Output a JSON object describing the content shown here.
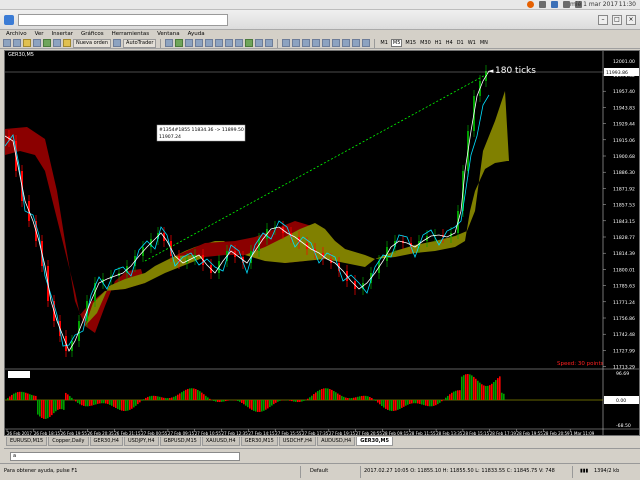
{
  "system_bar": {
    "date": "mié 1 mar 2017",
    "time": "11:30",
    "icons": [
      "firefox-icon",
      "wifi-icon",
      "bluetooth-icon",
      "volume-icon",
      "battery-icon"
    ]
  },
  "window": {
    "title": "",
    "address_value": ""
  },
  "menu": [
    "Archivo",
    "Ver",
    "Insertar",
    "Gráficos",
    "Herramientas",
    "Ventana",
    "Ayuda"
  ],
  "toolbar": {
    "new_order": "Nueva orden",
    "autotrader": "AutoTrader",
    "timeframes": [
      "M1",
      "M5",
      "M15",
      "M30",
      "H1",
      "H4",
      "D1",
      "W1",
      "MN"
    ],
    "selected_timeframe": "M5"
  },
  "chart": {
    "symbol": "GER30,M5",
    "annotation": "180 ticks",
    "speed_label": "Speed: 30 points",
    "tooltip_line1": "#1354#1855 11834.36 -> 11899.50",
    "tooltip_line2": "11907.24",
    "price_labels": [
      "11974.52",
      "11957.40",
      "11943.83",
      "11929.44",
      "11915.06",
      "11900.68",
      "11886.30",
      "11871.92",
      "11857.53",
      "11843.15",
      "11828.77",
      "11814.39",
      "11800.01",
      "11785.63",
      "11771.24",
      "11756.86",
      "11742.48",
      "11727.99",
      "11713.29"
    ],
    "current_price_label": "11993.86",
    "top_price_label": "12001.00",
    "indicator_labels": [
      "96.69",
      "0.00",
      "-68.50"
    ],
    "time_labels": [
      "26 Feb 2017",
      "26 Feb 18:15",
      "26 Feb 19:55",
      "26 Feb 20:35",
      "26 Feb 21:15",
      "27 Feb 00:55",
      "27 Feb 09:15",
      "27 Feb 10:55",
      "27 Feb 12:35",
      "27 Feb 14:15",
      "27 Feb 15:55",
      "27 Feb 17:35",
      "27 Feb 19:15",
      "27 Feb 20:55",
      "28 Feb 09:15",
      "28 Feb 11:55",
      "28 Feb 13:35",
      "28 Feb 15:15",
      "28 Feb 17:19",
      "28 Feb 19:55",
      "28 Feb 20:59",
      "1 Mar 11:09"
    ],
    "colors": {
      "background": "#000000",
      "cloud_bear": "#8b0000",
      "cloud_bull": "#808000",
      "price_line": "#ffffff",
      "fast_line": "#00e0ff",
      "trend_line": "#00ff00",
      "hist_up": "#00a000",
      "hist_down": "#ff0000",
      "speed_text": "#ff2020"
    }
  },
  "tabs": [
    "EURUSD,M15",
    "Copper,Daily",
    "GER30,H4",
    "USDJPY,H4",
    "GBPUSD,M15",
    "XAUUSD,H4",
    "GER30,M15",
    "USDCHF,H4",
    "AUDUSD,H4",
    "GER30,M5"
  ],
  "active_tab": "GER30,M5",
  "command_input": "a",
  "status": {
    "help": "Para obtener ayuda, pulse F1",
    "profile": "Default",
    "bar_info": "2017.02.27 10:05   O: 11855.10   H: 11855.50   L: 11833.55   C: 11845.75   V: 748",
    "traffic": "1394/2 kb"
  }
}
